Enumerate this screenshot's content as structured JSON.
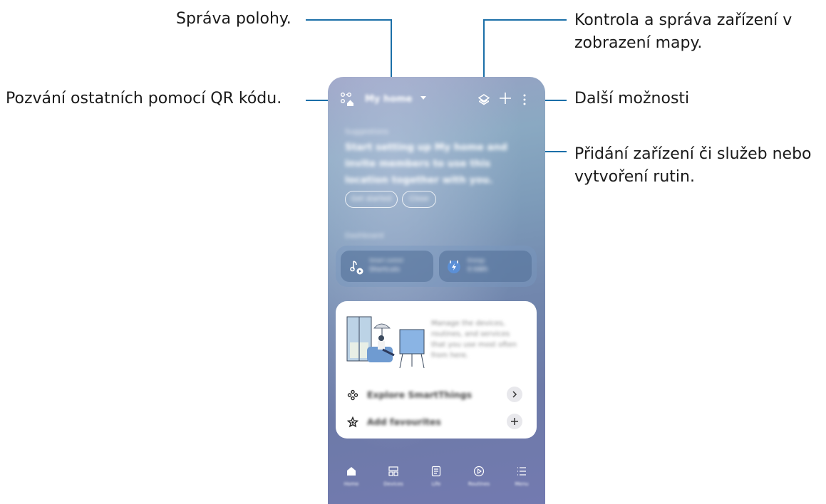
{
  "callouts": {
    "location": "Správa polohy.",
    "qr": "Pozvání ostatních pomocí QR kódu.",
    "map_line1": "Kontrola a správa zařízení v",
    "map_line2": "zobrazení mapy.",
    "more": "Další možnosti",
    "add_line1": "Přidání zařízení či služeb nebo",
    "add_line2": "vytvoření rutin."
  },
  "header": {
    "location_name": "My home",
    "qr_icon": "qr-invite-icon",
    "map_icon": "map-view-icon",
    "add_icon": "plus-icon",
    "more_icon": "more-options-icon"
  },
  "suggestion": {
    "heading": "Suggestions",
    "text": "Start setting up My home and invite members to use this location together with you.",
    "buttons": [
      "Get started",
      "Close"
    ]
  },
  "dashboard": {
    "heading": "Dashboard",
    "tiles": [
      {
        "icon": "music-play-icon",
        "title": "Smart control",
        "subtitle": "Shortcuts"
      },
      {
        "icon": "energy-icon",
        "title": "Energy",
        "subtitle": "0 kWh"
      }
    ]
  },
  "card": {
    "description": "Manage the devices, routines, and services that you use most often from here.",
    "rows": [
      {
        "icon": "smartthings-icon",
        "label": "Explore SmartThings",
        "action_icon": "chevron-right-icon"
      },
      {
        "icon": "star-icon",
        "label": "Add favourites",
        "action_icon": "plus-icon"
      }
    ]
  },
  "nav": [
    {
      "icon": "home-icon",
      "label": "Home"
    },
    {
      "icon": "devices-icon",
      "label": "Devices"
    },
    {
      "icon": "life-icon",
      "label": "Life"
    },
    {
      "icon": "routines-icon",
      "label": "Routines"
    },
    {
      "icon": "menu-icon",
      "label": "Menu"
    }
  ],
  "colors": {
    "callout_line": "#1b6fa8",
    "accent": "#ffffff"
  }
}
